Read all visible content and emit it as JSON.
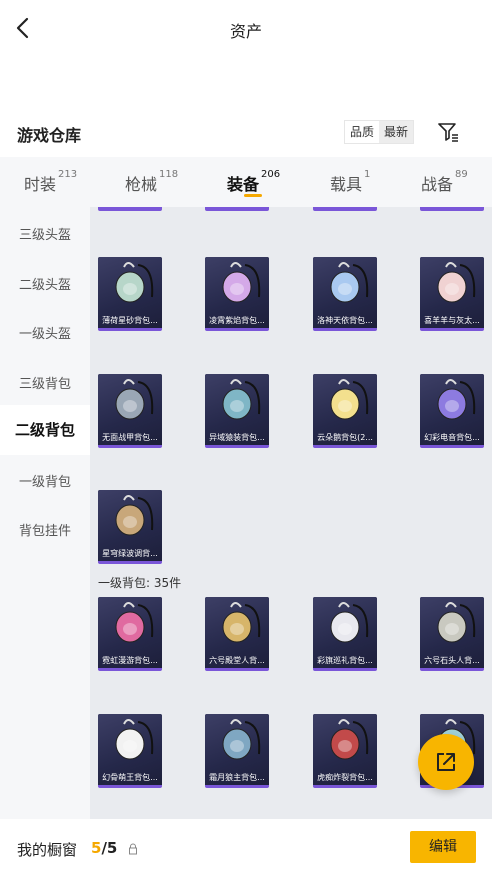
{
  "header": {
    "title": "资产"
  },
  "warehouse": {
    "title": "游戏仓库",
    "sort": [
      "品质",
      "最新"
    ]
  },
  "tabs": [
    {
      "label": "时装",
      "count": "213"
    },
    {
      "label": "枪械",
      "count": "118"
    },
    {
      "label": "装备",
      "count": "206"
    },
    {
      "label": "载具",
      "count": "1"
    },
    {
      "label": "战备",
      "count": "89"
    }
  ],
  "sidebar": [
    "三级头盔",
    "二级头盔",
    "一级头盔",
    "三级背包",
    "二级背包",
    "一级背包",
    "背包挂件"
  ],
  "groups": {
    "two_level": [
      "薄荷星砂背包...",
      "凌霄紫焰背包...",
      "洛神天依背包...",
      "喜羊羊与灰太...",
      "无面战甲背包...",
      "异域猿装背包...",
      "云朵鹅背包(2...",
      "幻彩电音背包...",
      "星穹绿波调背..."
    ],
    "one_level_label": "一级背包: 35件",
    "one_level": [
      "霓虹漫游背包...",
      "六号殿堂人背...",
      "彩旗巡礼背包...",
      "六号石头人背...",
      "幻骨萌王背包...",
      "霜月狼主背包...",
      "虎痴炸裂背包...",
      ""
    ]
  },
  "bottom": {
    "showcase_label": "我的橱窗",
    "current": "5",
    "total": "/5",
    "edit_label": "编辑"
  }
}
